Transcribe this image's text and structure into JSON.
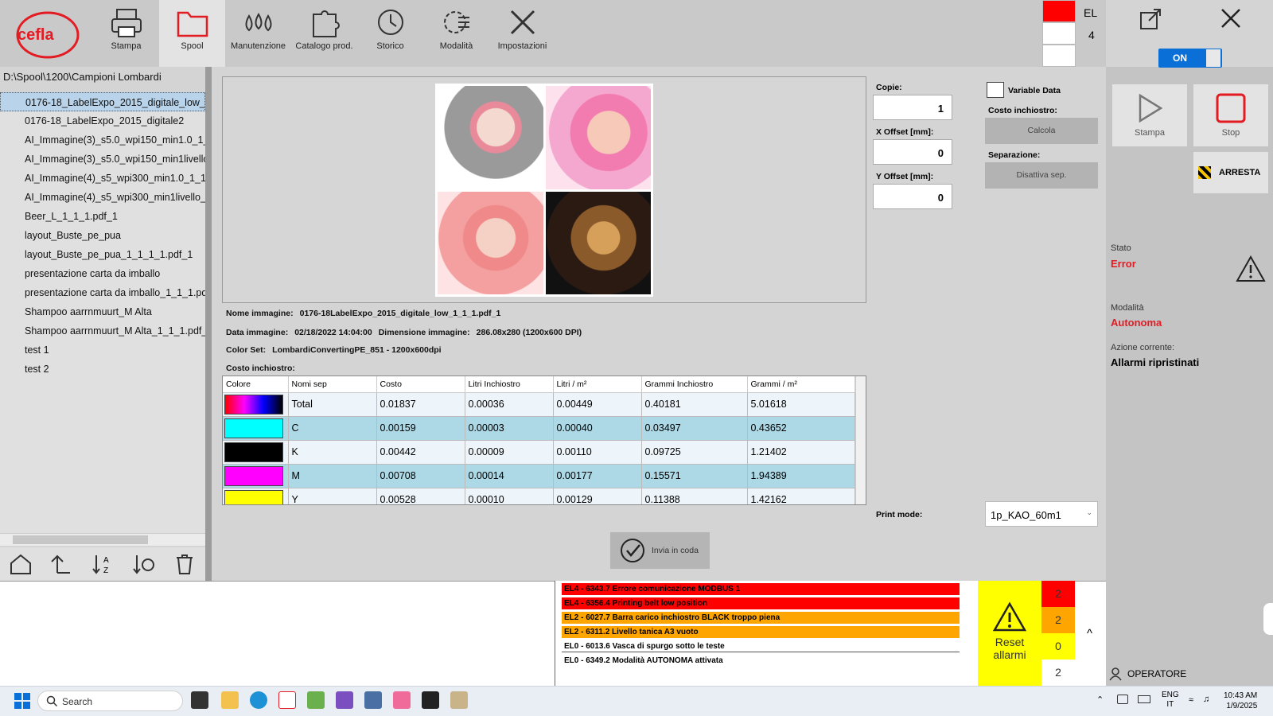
{
  "nav": {
    "items": [
      {
        "label": "Stampa",
        "icon": "printer-icon"
      },
      {
        "label": "Spool",
        "icon": "folder-icon"
      },
      {
        "label": "Manutenzione",
        "icon": "drops-icon"
      },
      {
        "label": "Catalogo prod.",
        "icon": "puzzle-icon"
      },
      {
        "label": "Storico",
        "icon": "history-icon"
      },
      {
        "label": "Modalità",
        "icon": "gear-list-icon"
      },
      {
        "label": "Impostazioni",
        "icon": "tools-icon"
      }
    ],
    "active": "Spool"
  },
  "logo": {
    "text": "cefla"
  },
  "indicator": {
    "label": "EL",
    "count": "4",
    "colors": [
      "#ff0000",
      "#ffffff",
      "#ffffff"
    ]
  },
  "toggle": {
    "label": "ON"
  },
  "path": "D:\\Spool\\1200\\Campioni Lombardi",
  "files": [
    "0176-18_LabelExpo_2015_digitale_low_1_",
    "0176-18_LabelExpo_2015_digitale2",
    "AI_Immagine(3)_s5.0_wpi150_min1.0_1_1_",
    "AI_Immagine(3)_s5.0_wpi150_min1livello_",
    "AI_Immagine(4)_s5_wpi300_min1.0_1_1_1",
    "AI_Immagine(4)_s5_wpi300_min1livello_1",
    "Beer_L_1_1_1.pdf_1",
    "layout_Buste_pe_pua",
    "layout_Buste_pe_pua_1_1_1_1.pdf_1",
    "presentazione carta da imballo",
    "presentazione carta da imballo_1_1_1.pdf",
    "Shampoo aarrnmuurt_M Alta",
    "Shampoo aarrnmuurt_M Alta_1_1_1.pdf_1",
    "test 1",
    "test 2"
  ],
  "info": {
    "nome_label": "Nome immagine:",
    "nome": "0176-18LabelExpo_2015_digitale_low_1_1_1.pdf_1",
    "data_label": "Data immagine:",
    "data": "02/18/2022 14:04:00",
    "dim_label": "Dimensione immagine:",
    "dim": "286.08x280 (1200x600 DPI)",
    "colorset_label": "Color Set:",
    "colorset": "LombardiConvertingPE_851 - 1200x600dpi",
    "costo_label": "Costo inchiostro:"
  },
  "controls": {
    "copie_label": "Copie:",
    "copie": "1",
    "xoff_label": "X Offset [mm]:",
    "xoff": "0",
    "yoff_label": "Y Offset [mm]:",
    "yoff": "0",
    "variable_label": "Variable Data",
    "costo_label": "Costo inchiostro:",
    "calcola": "Calcola",
    "sep_label": "Separazione:",
    "sep_btn": "Disattiva sep.",
    "printmode_label": "Print mode:",
    "printmode": "1p_KAO_60m1"
  },
  "table": {
    "headers": [
      "Colore",
      "Nomi sep",
      "Costo",
      "Litri Inchiostro",
      "Litri / m²",
      "Grammi Inchiostro",
      "Grammi / m²"
    ],
    "rows": [
      {
        "swatch": "gradient",
        "name": "Total",
        "costo": "0.01837",
        "litri": "0.00036",
        "litri_m2": "0.00449",
        "grammi": "0.40181",
        "grammi_m2": "5.01618"
      },
      {
        "swatch": "#00ffff",
        "name": "C",
        "costo": "0.00159",
        "litri": "0.00003",
        "litri_m2": "0.00040",
        "grammi": "0.03497",
        "grammi_m2": "0.43652"
      },
      {
        "swatch": "#000000",
        "name": "K",
        "costo": "0.00442",
        "litri": "0.00009",
        "litri_m2": "0.00110",
        "grammi": "0.09725",
        "grammi_m2": "1.21402"
      },
      {
        "swatch": "#ff00ff",
        "name": "M",
        "costo": "0.00708",
        "litri": "0.00014",
        "litri_m2": "0.00177",
        "grammi": "0.15571",
        "grammi_m2": "1.94389"
      },
      {
        "swatch": "#ffff00",
        "name": "Y",
        "costo": "0.00528",
        "litri": "0.00010",
        "litri_m2": "0.00129",
        "grammi": "0.11388",
        "grammi_m2": "1.42162"
      }
    ]
  },
  "invia": {
    "label": "Invia in coda"
  },
  "right": {
    "stampa": "Stampa",
    "stop": "Stop",
    "arresta": "ARRESTA",
    "stato_label": "Stato",
    "stato": "Error",
    "modalita_label": "Modalità",
    "modalita": "Autonoma",
    "azione_label": "Azione corrente:",
    "azione": "Allarmi ripristinati",
    "operatore": "OPERATORE"
  },
  "alarms": [
    {
      "text": "EL4 - 6343.7   Errore comunicazione MODBUS 1",
      "color": "#ff0000"
    },
    {
      "text": "EL4 - 6356.4 Printing belt low position",
      "color": "#ff0000"
    },
    {
      "text": "EL2 - 6027.7   Barra carico inchiostro BLACK troppo piena",
      "color": "#ffa500"
    },
    {
      "text": "EL2 - 6311.2   Livello tanica A3 vuoto",
      "color": "#ffa500"
    },
    {
      "text": "EL0 - 6013.6   Vasca di spurgo sotto le teste",
      "color": "#ffffff"
    },
    {
      "text": "EL0 - 6349.2   Modalità AUTONOMA attivata",
      "color": "#ffffff"
    }
  ],
  "reset": {
    "label1": "Reset",
    "label2": "allarmi"
  },
  "counts": [
    {
      "value": "2",
      "color": "#ff0000"
    },
    {
      "value": "2",
      "color": "#ffa500"
    },
    {
      "value": "0",
      "color": "#ffff00"
    },
    {
      "value": "2",
      "color": "#ffffff"
    }
  ],
  "expand": "^",
  "taskbar": {
    "search": "Search",
    "lang1": "ENG",
    "lang2": "IT",
    "time": "10:43 AM",
    "date": "1/9/2025"
  }
}
